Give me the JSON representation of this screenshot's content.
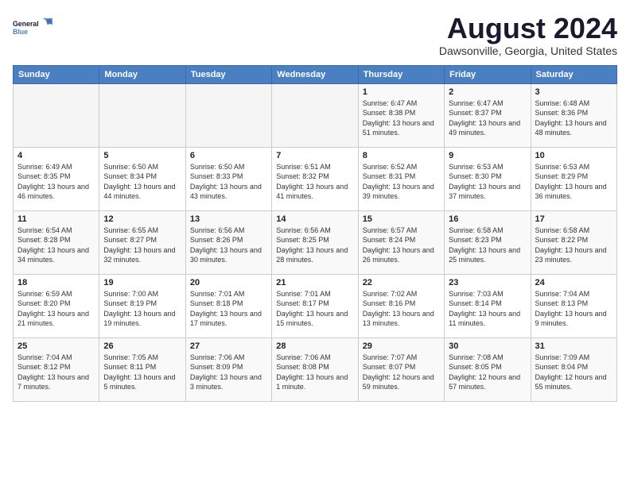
{
  "logo": {
    "line1": "General",
    "line2": "Blue"
  },
  "title": "August 2024",
  "subtitle": "Dawsonville, Georgia, United States",
  "days_of_week": [
    "Sunday",
    "Monday",
    "Tuesday",
    "Wednesday",
    "Thursday",
    "Friday",
    "Saturday"
  ],
  "weeks": [
    [
      {
        "day": "",
        "sunrise": "",
        "sunset": "",
        "daylight": ""
      },
      {
        "day": "",
        "sunrise": "",
        "sunset": "",
        "daylight": ""
      },
      {
        "day": "",
        "sunrise": "",
        "sunset": "",
        "daylight": ""
      },
      {
        "day": "",
        "sunrise": "",
        "sunset": "",
        "daylight": ""
      },
      {
        "day": "1",
        "sunrise": "Sunrise: 6:47 AM",
        "sunset": "Sunset: 8:38 PM",
        "daylight": "Daylight: 13 hours and 51 minutes."
      },
      {
        "day": "2",
        "sunrise": "Sunrise: 6:47 AM",
        "sunset": "Sunset: 8:37 PM",
        "daylight": "Daylight: 13 hours and 49 minutes."
      },
      {
        "day": "3",
        "sunrise": "Sunrise: 6:48 AM",
        "sunset": "Sunset: 8:36 PM",
        "daylight": "Daylight: 13 hours and 48 minutes."
      }
    ],
    [
      {
        "day": "4",
        "sunrise": "Sunrise: 6:49 AM",
        "sunset": "Sunset: 8:35 PM",
        "daylight": "Daylight: 13 hours and 46 minutes."
      },
      {
        "day": "5",
        "sunrise": "Sunrise: 6:50 AM",
        "sunset": "Sunset: 8:34 PM",
        "daylight": "Daylight: 13 hours and 44 minutes."
      },
      {
        "day": "6",
        "sunrise": "Sunrise: 6:50 AM",
        "sunset": "Sunset: 8:33 PM",
        "daylight": "Daylight: 13 hours and 43 minutes."
      },
      {
        "day": "7",
        "sunrise": "Sunrise: 6:51 AM",
        "sunset": "Sunset: 8:32 PM",
        "daylight": "Daylight: 13 hours and 41 minutes."
      },
      {
        "day": "8",
        "sunrise": "Sunrise: 6:52 AM",
        "sunset": "Sunset: 8:31 PM",
        "daylight": "Daylight: 13 hours and 39 minutes."
      },
      {
        "day": "9",
        "sunrise": "Sunrise: 6:53 AM",
        "sunset": "Sunset: 8:30 PM",
        "daylight": "Daylight: 13 hours and 37 minutes."
      },
      {
        "day": "10",
        "sunrise": "Sunrise: 6:53 AM",
        "sunset": "Sunset: 8:29 PM",
        "daylight": "Daylight: 13 hours and 36 minutes."
      }
    ],
    [
      {
        "day": "11",
        "sunrise": "Sunrise: 6:54 AM",
        "sunset": "Sunset: 8:28 PM",
        "daylight": "Daylight: 13 hours and 34 minutes."
      },
      {
        "day": "12",
        "sunrise": "Sunrise: 6:55 AM",
        "sunset": "Sunset: 8:27 PM",
        "daylight": "Daylight: 13 hours and 32 minutes."
      },
      {
        "day": "13",
        "sunrise": "Sunrise: 6:56 AM",
        "sunset": "Sunset: 8:26 PM",
        "daylight": "Daylight: 13 hours and 30 minutes."
      },
      {
        "day": "14",
        "sunrise": "Sunrise: 6:56 AM",
        "sunset": "Sunset: 8:25 PM",
        "daylight": "Daylight: 13 hours and 28 minutes."
      },
      {
        "day": "15",
        "sunrise": "Sunrise: 6:57 AM",
        "sunset": "Sunset: 8:24 PM",
        "daylight": "Daylight: 13 hours and 26 minutes."
      },
      {
        "day": "16",
        "sunrise": "Sunrise: 6:58 AM",
        "sunset": "Sunset: 8:23 PM",
        "daylight": "Daylight: 13 hours and 25 minutes."
      },
      {
        "day": "17",
        "sunrise": "Sunrise: 6:58 AM",
        "sunset": "Sunset: 8:22 PM",
        "daylight": "Daylight: 13 hours and 23 minutes."
      }
    ],
    [
      {
        "day": "18",
        "sunrise": "Sunrise: 6:59 AM",
        "sunset": "Sunset: 8:20 PM",
        "daylight": "Daylight: 13 hours and 21 minutes."
      },
      {
        "day": "19",
        "sunrise": "Sunrise: 7:00 AM",
        "sunset": "Sunset: 8:19 PM",
        "daylight": "Daylight: 13 hours and 19 minutes."
      },
      {
        "day": "20",
        "sunrise": "Sunrise: 7:01 AM",
        "sunset": "Sunset: 8:18 PM",
        "daylight": "Daylight: 13 hours and 17 minutes."
      },
      {
        "day": "21",
        "sunrise": "Sunrise: 7:01 AM",
        "sunset": "Sunset: 8:17 PM",
        "daylight": "Daylight: 13 hours and 15 minutes."
      },
      {
        "day": "22",
        "sunrise": "Sunrise: 7:02 AM",
        "sunset": "Sunset: 8:16 PM",
        "daylight": "Daylight: 13 hours and 13 minutes."
      },
      {
        "day": "23",
        "sunrise": "Sunrise: 7:03 AM",
        "sunset": "Sunset: 8:14 PM",
        "daylight": "Daylight: 13 hours and 11 minutes."
      },
      {
        "day": "24",
        "sunrise": "Sunrise: 7:04 AM",
        "sunset": "Sunset: 8:13 PM",
        "daylight": "Daylight: 13 hours and 9 minutes."
      }
    ],
    [
      {
        "day": "25",
        "sunrise": "Sunrise: 7:04 AM",
        "sunset": "Sunset: 8:12 PM",
        "daylight": "Daylight: 13 hours and 7 minutes."
      },
      {
        "day": "26",
        "sunrise": "Sunrise: 7:05 AM",
        "sunset": "Sunset: 8:11 PM",
        "daylight": "Daylight: 13 hours and 5 minutes."
      },
      {
        "day": "27",
        "sunrise": "Sunrise: 7:06 AM",
        "sunset": "Sunset: 8:09 PM",
        "daylight": "Daylight: 13 hours and 3 minutes."
      },
      {
        "day": "28",
        "sunrise": "Sunrise: 7:06 AM",
        "sunset": "Sunset: 8:08 PM",
        "daylight": "Daylight: 13 hours and 1 minute."
      },
      {
        "day": "29",
        "sunrise": "Sunrise: 7:07 AM",
        "sunset": "Sunset: 8:07 PM",
        "daylight": "Daylight: 12 hours and 59 minutes."
      },
      {
        "day": "30",
        "sunrise": "Sunrise: 7:08 AM",
        "sunset": "Sunset: 8:05 PM",
        "daylight": "Daylight: 12 hours and 57 minutes."
      },
      {
        "day": "31",
        "sunrise": "Sunrise: 7:09 AM",
        "sunset": "Sunset: 8:04 PM",
        "daylight": "Daylight: 12 hours and 55 minutes."
      }
    ]
  ]
}
